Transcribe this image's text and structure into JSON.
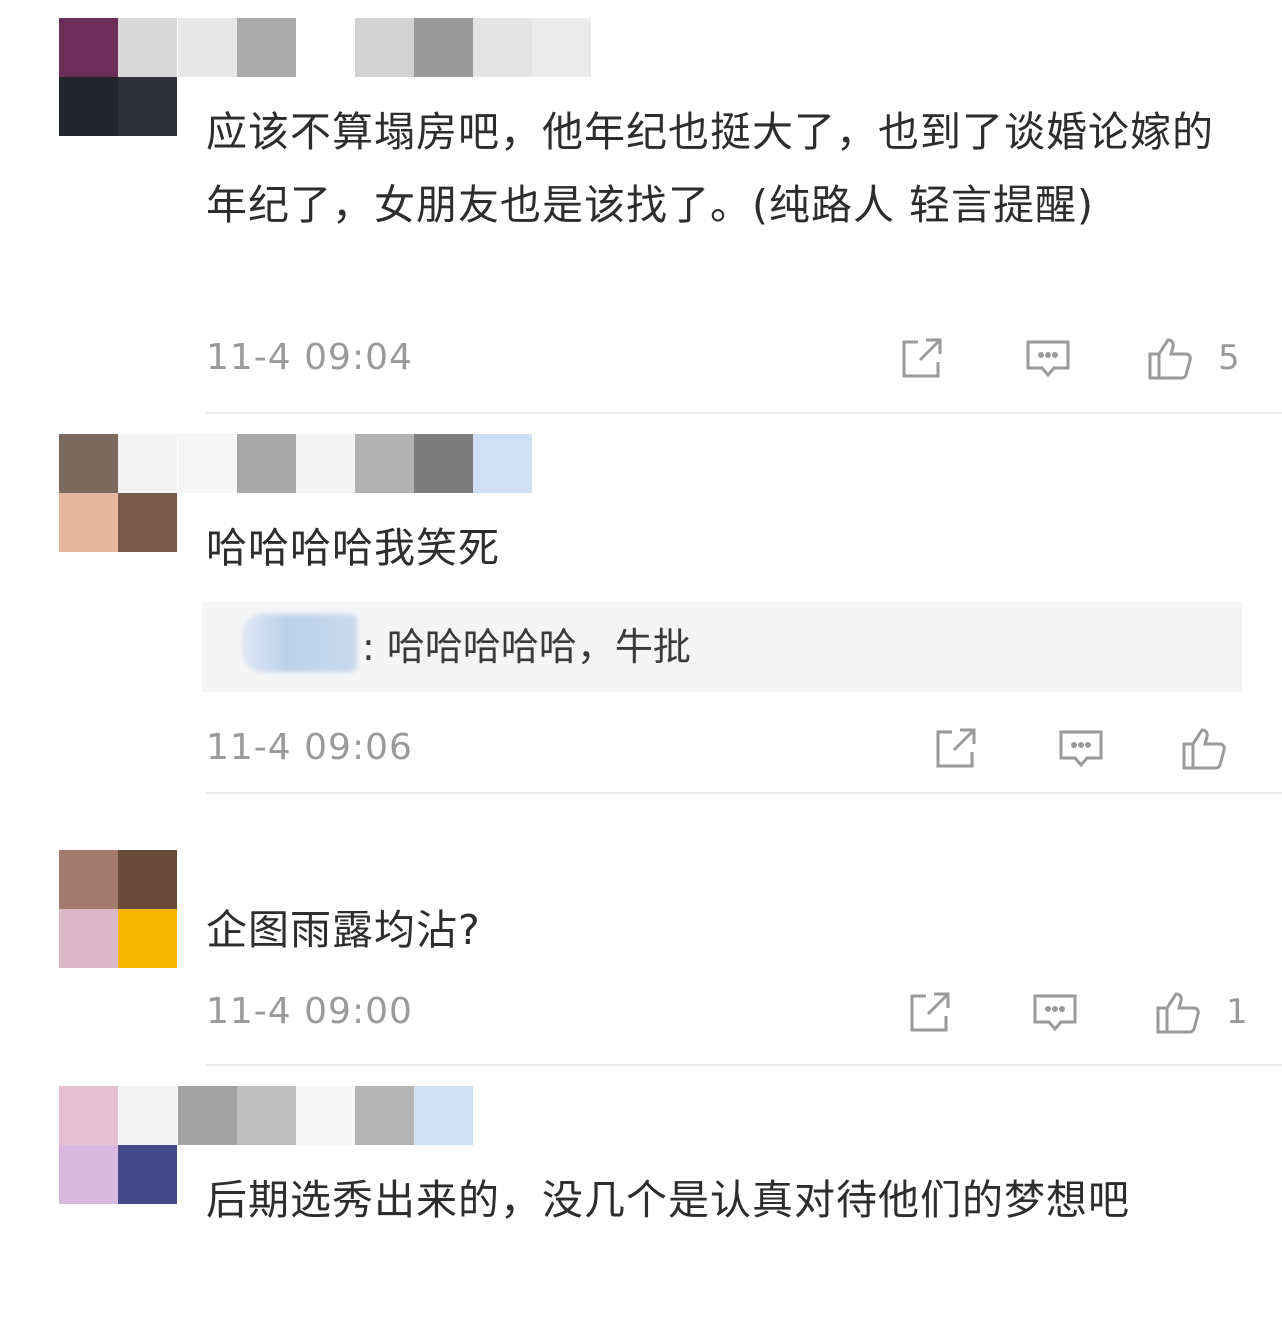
{
  "comments": [
    {
      "text": "应该不算塌房吧，他年纪也挺大了，也到了谈婚论嫁的年纪了，女朋友也是该找了。(纯路人 轻言提醒)",
      "time": "11-4 09:04",
      "likes": "5",
      "avatar_colors": [
        "#6b2f5a",
        "#d9d9d9",
        "#22252b",
        "#2e3038"
      ],
      "name_colors": [
        "#e8e8e8",
        "#ababab",
        "#ffffff",
        "#d2d2d2",
        "#9a9a9a",
        "#e4e4e4",
        "#ebebeb"
      ]
    },
    {
      "text": "哈哈哈哈我笑死",
      "time": "11-4 09:06",
      "likes": "",
      "reply": {
        "text": ": 哈哈哈哈哈，牛批"
      },
      "avatar_colors": [
        "#7d6a5f",
        "#f3f3f3",
        "#e5b7a0",
        "#7a5a4a"
      ],
      "name_colors": [
        "#f6f6f6",
        "#a8a8a8",
        "#f4f4f4",
        "#b2b2b2",
        "#7d7d7d",
        "#cfe0f5"
      ]
    },
    {
      "text": "企图雨露均沾?",
      "time": "11-4 09:00",
      "likes": "1",
      "avatar_colors": [
        "#a47a6e",
        "#6a4a3a",
        "#dcb7c5",
        "#f7b700"
      ],
      "name_colors": []
    },
    {
      "text": "后期选秀出来的，没几个是认真对待他们的梦想吧",
      "time": "",
      "likes": "",
      "avatar_colors": [
        "#e6bfd0",
        "#f4f4f4",
        "#dab7de",
        "#454b8a"
      ],
      "name_colors": [
        "#a3a3a3",
        "#bdbdbd",
        "#f7f7f7",
        "#b4b4b4",
        "#cfe0f5"
      ]
    }
  ],
  "icons": {
    "share": "share-icon",
    "comment": "comment-icon",
    "like": "thumbs-up-icon"
  }
}
